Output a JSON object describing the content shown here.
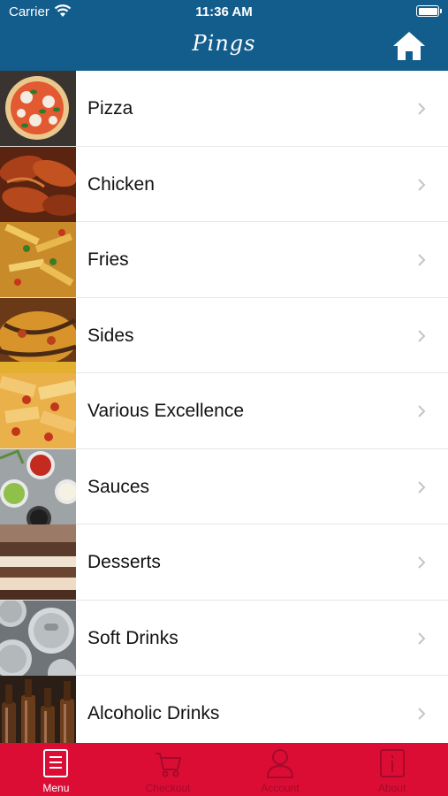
{
  "status_bar": {
    "carrier": "Carrier",
    "time": "11:36 AM"
  },
  "header": {
    "title": "Pings",
    "home_icon": "home-icon"
  },
  "colors": {
    "header_bg": "#135d8c",
    "tabbar_bg": "#db0d35",
    "tab_inactive": "#a50a2a"
  },
  "menu": {
    "items": [
      {
        "label": "Pizza"
      },
      {
        "label": "Chicken"
      },
      {
        "label": "Fries"
      },
      {
        "label": "Sides"
      },
      {
        "label": "Various Excellence"
      },
      {
        "label": "Sauces"
      },
      {
        "label": "Desserts"
      },
      {
        "label": "Soft Drinks"
      },
      {
        "label": "Alcoholic Drinks"
      }
    ]
  },
  "tabbar": {
    "tabs": [
      {
        "label": "Menu",
        "icon": "menu-icon",
        "active": true
      },
      {
        "label": "Checkout",
        "icon": "cart-icon",
        "active": false
      },
      {
        "label": "Account",
        "icon": "user-icon",
        "active": false
      },
      {
        "label": "About",
        "icon": "info-icon",
        "active": false
      }
    ]
  }
}
